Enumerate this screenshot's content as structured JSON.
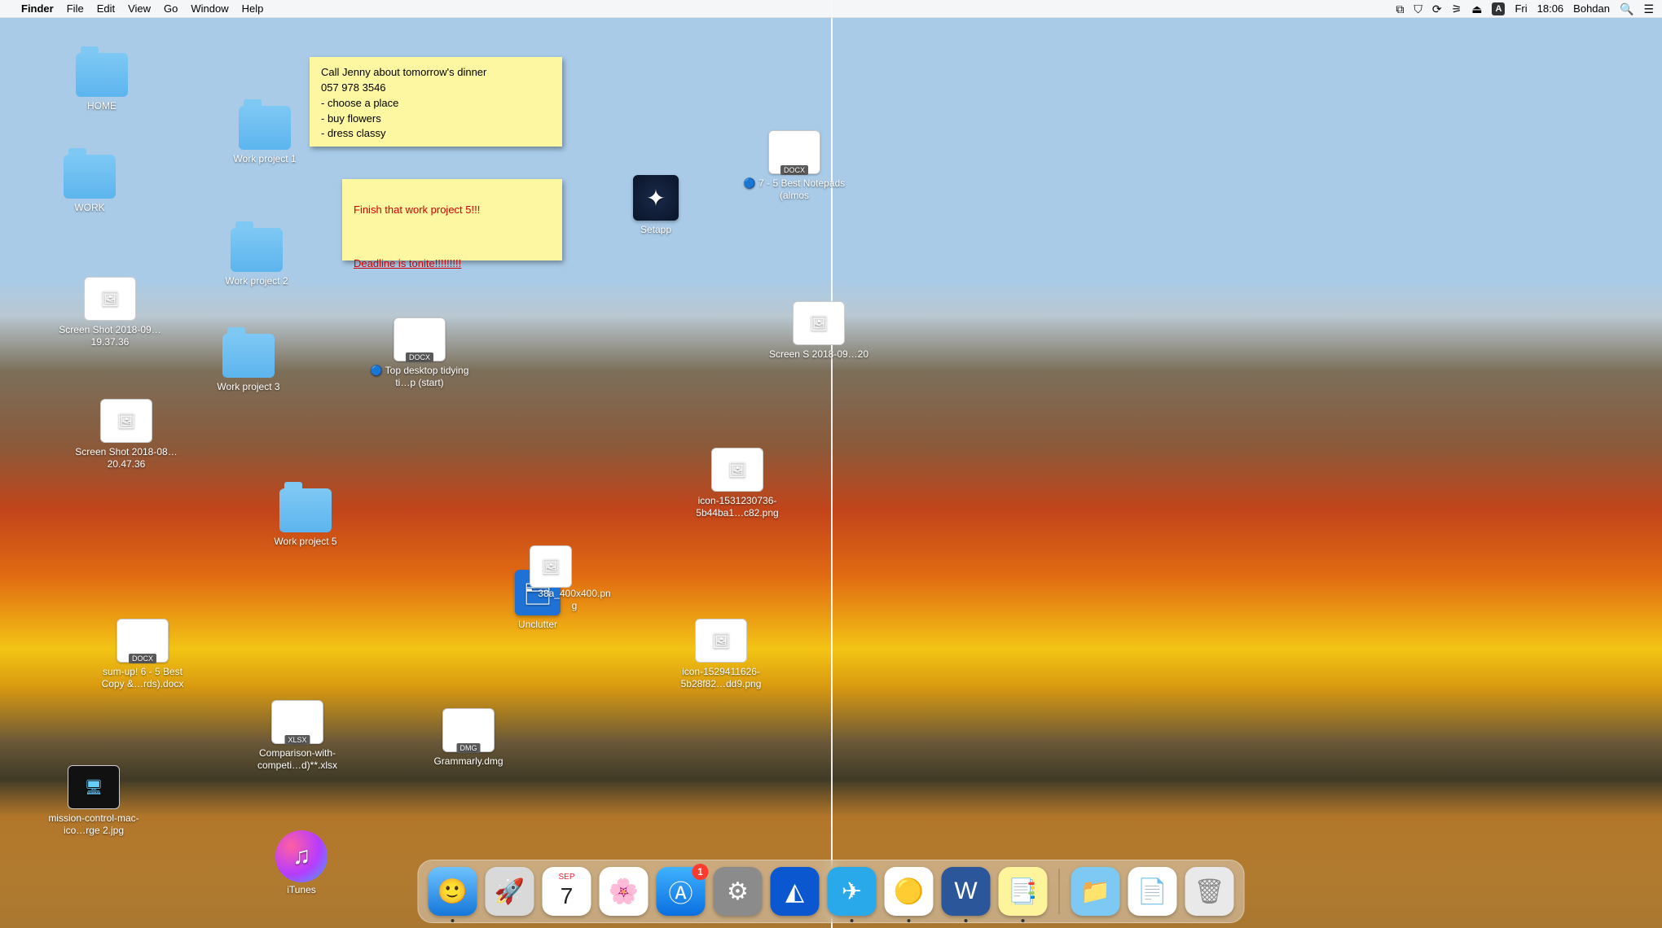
{
  "menubar": {
    "apple": "",
    "app_name": "Finder",
    "menus": [
      "File",
      "Edit",
      "View",
      "Go",
      "Window",
      "Help"
    ],
    "right": {
      "input_badge": "A",
      "day": "Fri",
      "time": "18:06",
      "user": "Bohdan"
    }
  },
  "sticky1": "Call Jenny about tomorrow's dinner\n057 978 3546\n- choose a place\n- buy flowers\n- dress classy",
  "sticky2_line1": "Finish that work project 5!!!",
  "sticky2_line2": "Deadline is tonite!!!!!!!!!",
  "folders": {
    "home": "HOME",
    "work": "WORK",
    "wp1": "Work project 1",
    "wp2": "Work project 2",
    "wp3": "Work project 3",
    "wp5": "Work project 5"
  },
  "apps": {
    "setapp": "Setapp",
    "unclutter": "Unclutter",
    "itunes": "iTunes"
  },
  "files": {
    "ss1": "Screen Shot 2018-09…19.37.36",
    "ss2": "Screen Shot 2018-08…20.47.36",
    "ss3": "Screen S 2018-09…20",
    "docx1": "🔵 7 - 5 Best Notepads (almos",
    "docx2": "🔵 Top desktop tidying ti…p (start)",
    "docx3": "sum-up! 6 - 5 Best Copy &…rds).docx",
    "xlsx1": "Comparison-with-competi…d)**.xlsx",
    "dmg1": "Grammarly.dmg",
    "png1": "icon-1531230736-5b44ba1…c82.png",
    "png2": "icon-1529411626-5b28f82…dd9.png",
    "png3": "38a_400x400.png",
    "jpg1": "mission-control-mac-ico…rge 2.jpg"
  },
  "ext": {
    "docx": "DOCX",
    "xlsx": "XLSX",
    "dmg": "DMG"
  },
  "dock": {
    "appstore_badge": "1",
    "calendar_month": "SEP",
    "calendar_day": "7"
  }
}
